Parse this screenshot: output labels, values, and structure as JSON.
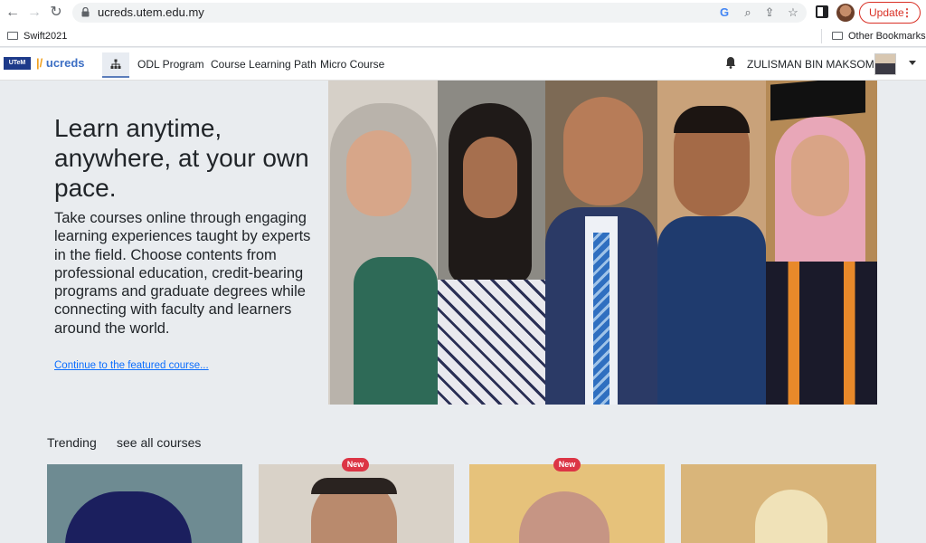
{
  "browser": {
    "url": "ucreds.utem.edu.my",
    "update_label": "Update",
    "bookmarks": {
      "left": "Swift2021",
      "right": "Other Bookmarks"
    }
  },
  "site": {
    "logo_utem": "UTeM",
    "logo_ucreds": "ucreds",
    "nav": [
      "ODL Program",
      "Course Learning Path",
      "Micro Course"
    ],
    "user": "ZULISMAN BIN MAKSOM -"
  },
  "hero": {
    "title": "Learn anytime, anywhere, at your own pace.",
    "body": "Take courses online through engaging learning experiences taught by experts in the field. Choose contents from professional education, credit-bearing programs and graduate degrees while connecting with faculty and learners around the world.",
    "link": "Continue to the featured course..."
  },
  "trending": {
    "label": "Trending",
    "see_all": "see all courses",
    "badge": "New"
  },
  "colors": {
    "accent": "#0d6efd",
    "badge": "#dc3545",
    "update": "#d93025"
  }
}
